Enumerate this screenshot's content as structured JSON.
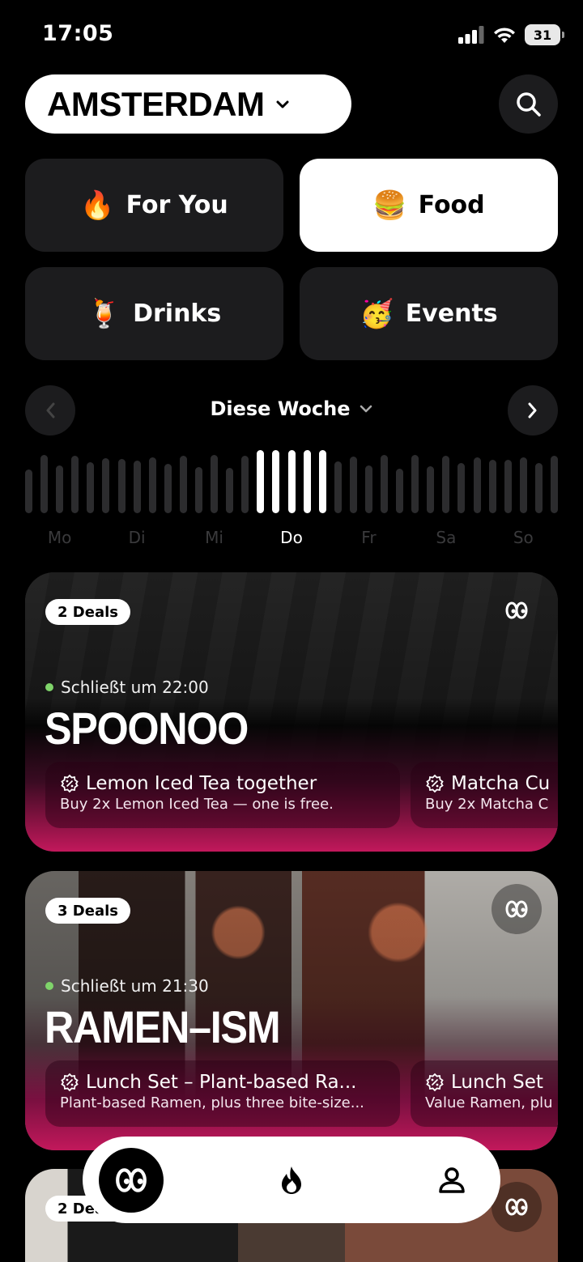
{
  "status": {
    "time": "17:05",
    "battery": "31"
  },
  "header": {
    "city": "AMSTERDAM"
  },
  "categories": [
    {
      "label": "For You",
      "emoji": "🔥",
      "active": false
    },
    {
      "label": "Food",
      "emoji": "🍔",
      "active": true
    },
    {
      "label": "Drinks",
      "emoji": "🍹",
      "active": false
    },
    {
      "label": "Events",
      "emoji": "🥳",
      "active": false
    }
  ],
  "week": {
    "label": "Diese Woche",
    "days": [
      "Mo",
      "Di",
      "Mi",
      "Do",
      "Fr",
      "Sa",
      "So"
    ],
    "active_day": "Do"
  },
  "venues": [
    {
      "badge": "2 Deals",
      "hours": "Schließt um 22:00",
      "name": "SPOONOO",
      "deals": [
        {
          "title": "Lemon Iced Tea together",
          "subtitle": "Buy 2x Lemon Iced Tea —  one is free."
        },
        {
          "title": "Matcha Cu",
          "subtitle": "Buy 2x Matcha C"
        }
      ]
    },
    {
      "badge": "3 Deals",
      "hours": "Schließt um 21:30",
      "name": "RAMEN–ISM",
      "deals": [
        {
          "title": "Lunch Set – Plant-based Ra...",
          "subtitle": "Plant-based Ramen, plus three bite-size..."
        },
        {
          "title": "Lunch Set",
          "subtitle": "Value Ramen, plu"
        }
      ]
    },
    {
      "badge": "2 Deals"
    }
  ],
  "colors": {
    "accent": "#c2185b",
    "inactive_bar": "#2c2c2e",
    "hours_dot": "#7fd46a"
  },
  "bottom_nav": [
    "eyes-icon",
    "flame-icon",
    "profile-icon"
  ]
}
